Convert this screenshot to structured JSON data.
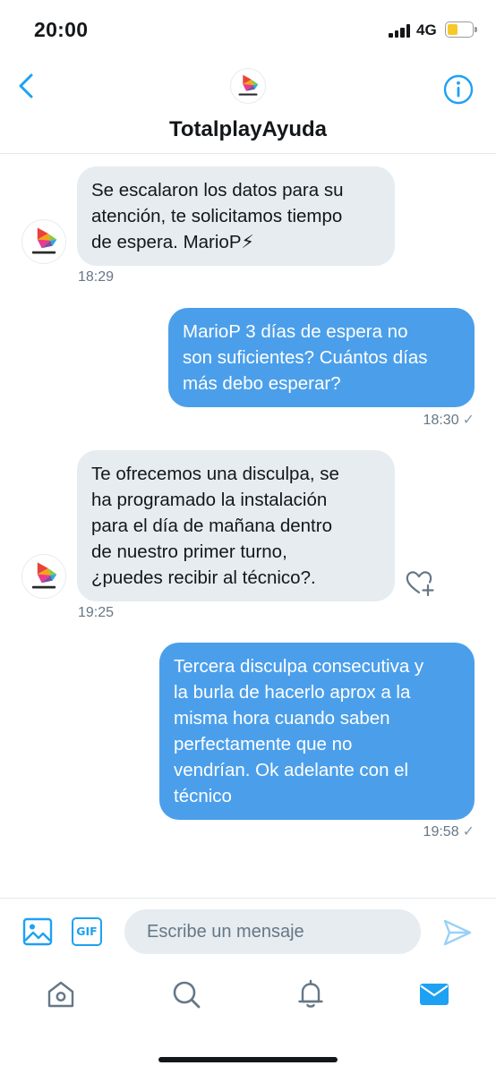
{
  "status_bar": {
    "time": "20:00",
    "network": "4G",
    "battery_level": 0.45,
    "battery_color": "#f6c929"
  },
  "header": {
    "contact_name": "TotalplayAyuda",
    "avatar_label": "TotalplayAyuda",
    "back_icon": "chevron-left-icon",
    "info_icon": "info-icon"
  },
  "messages": [
    {
      "direction": "incoming",
      "text": "Se escalaron los datos para su\natención, te solicitamos tiempo\nde espera.  MarioP⚡",
      "time": "18:29"
    },
    {
      "direction": "outgoing",
      "text": "MarioP 3 días de espera no\nson suficientes? Cuántos días\nmás debo esperar?",
      "time": "18:30",
      "status": "✓"
    },
    {
      "direction": "incoming",
      "text": "Te ofrecemos una disculpa,  se\nha programado la instalación\npara el día de mañana dentro\nde nuestro primer turno,\n¿puedes recibir al técnico?.",
      "time": "19:25"
    },
    {
      "direction": "outgoing",
      "text": "Tercera disculpa consecutiva y\nla burla de hacerlo aprox a la\nmisma hora cuando saben\nperfectamente que no\nvendrían. Ok adelante con el\ntécnico",
      "time": "19:58",
      "status": "✓"
    }
  ],
  "composer": {
    "gif_label": "GIF",
    "placeholder": "Escribe un mensaje",
    "media_icon": "image-icon",
    "send_icon": "send-icon"
  },
  "tabs": [
    {
      "name": "home",
      "icon": "home-icon"
    },
    {
      "name": "search",
      "icon": "search-icon"
    },
    {
      "name": "notifications",
      "icon": "bell-icon"
    },
    {
      "name": "messages",
      "icon": "envelope-icon",
      "active": true
    }
  ],
  "colors": {
    "accent": "#1da1f2",
    "outgoing_bubble": "#4b9fea",
    "incoming_bubble": "#e6ecf0",
    "inactive_icon": "#657786"
  }
}
